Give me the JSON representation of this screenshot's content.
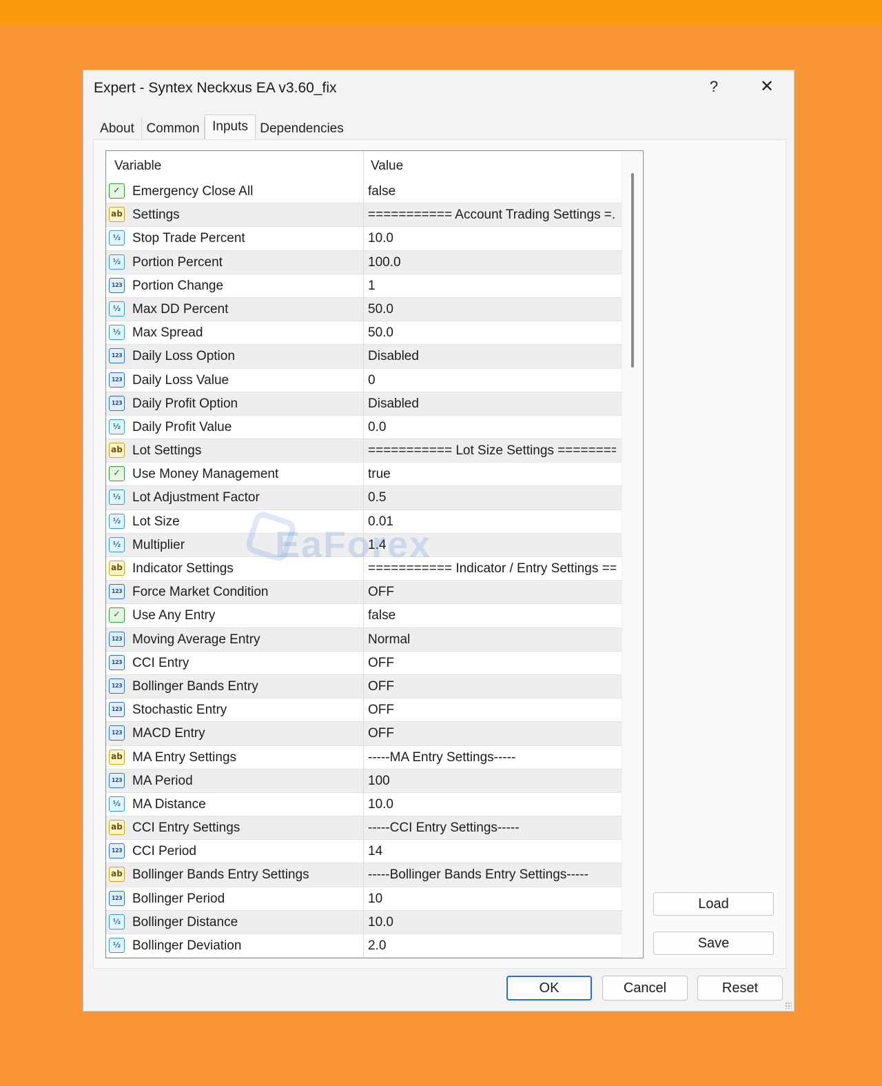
{
  "window": {
    "title": "Expert - Syntex Neckxus EA v3.60_fix",
    "help_label": "?",
    "close_label": "✕"
  },
  "tabs": [
    {
      "label": "About"
    },
    {
      "label": "Common"
    },
    {
      "label": "Inputs",
      "active": true
    },
    {
      "label": "Dependencies"
    }
  ],
  "grid": {
    "headers": {
      "variable": "Variable",
      "value": "Value"
    },
    "rows": [
      {
        "type": "bool",
        "variable": "Emergency Close All",
        "value": "false"
      },
      {
        "type": "string",
        "variable": "Settings",
        "value": "=========== Account Trading Settings =..."
      },
      {
        "type": "double",
        "variable": "Stop Trade Percent",
        "value": "10.0"
      },
      {
        "type": "double",
        "variable": "Portion Percent",
        "value": "100.0"
      },
      {
        "type": "int",
        "variable": "Portion Change",
        "value": "1"
      },
      {
        "type": "double",
        "variable": "Max DD Percent",
        "value": "50.0"
      },
      {
        "type": "double",
        "variable": "Max Spread",
        "value": "50.0"
      },
      {
        "type": "int",
        "variable": "Daily Loss Option",
        "value": "Disabled"
      },
      {
        "type": "int",
        "variable": "Daily Loss Value",
        "value": "0"
      },
      {
        "type": "int",
        "variable": "Daily Profit Option",
        "value": "Disabled"
      },
      {
        "type": "double",
        "variable": "Daily Profit Value",
        "value": "0.0"
      },
      {
        "type": "string",
        "variable": "Lot Settings",
        "value": "=========== Lot Size Settings ========..."
      },
      {
        "type": "bool",
        "variable": "Use Money Management",
        "value": "true"
      },
      {
        "type": "double",
        "variable": "Lot Adjustment Factor",
        "value": "0.5"
      },
      {
        "type": "double",
        "variable": "Lot Size",
        "value": "0.01"
      },
      {
        "type": "double",
        "variable": "Multiplier",
        "value": "1.4"
      },
      {
        "type": "string",
        "variable": "Indicator Settings",
        "value": "=========== Indicator / Entry Settings ==..."
      },
      {
        "type": "int",
        "variable": "Force Market Condition",
        "value": "OFF"
      },
      {
        "type": "bool",
        "variable": "Use Any Entry",
        "value": "false"
      },
      {
        "type": "int",
        "variable": "Moving Average Entry",
        "value": "Normal"
      },
      {
        "type": "int",
        "variable": "CCI Entry",
        "value": "OFF"
      },
      {
        "type": "int",
        "variable": "Bollinger Bands Entry",
        "value": "OFF"
      },
      {
        "type": "int",
        "variable": "Stochastic Entry",
        "value": "OFF"
      },
      {
        "type": "int",
        "variable": "MACD Entry",
        "value": "OFF"
      },
      {
        "type": "string",
        "variable": "MA Entry Settings",
        "value": "-----MA Entry Settings-----"
      },
      {
        "type": "int",
        "variable": "MA Period",
        "value": "100"
      },
      {
        "type": "double",
        "variable": "MA Distance",
        "value": "10.0"
      },
      {
        "type": "string",
        "variable": "CCI Entry Settings",
        "value": "-----CCI Entry Settings-----"
      },
      {
        "type": "int",
        "variable": "CCI Period",
        "value": "14"
      },
      {
        "type": "string",
        "variable": "Bollinger Bands Entry Settings",
        "value": "-----Bollinger Bands Entry Settings-----"
      },
      {
        "type": "int",
        "variable": "Bollinger Period",
        "value": "10"
      },
      {
        "type": "double",
        "variable": "Bollinger Distance",
        "value": "10.0"
      },
      {
        "type": "double",
        "variable": "Bollinger Deviation",
        "value": "2.0"
      }
    ]
  },
  "icon_glyphs": {
    "bool": "✓",
    "string": "ab",
    "double": "½",
    "int": "123"
  },
  "watermark": "EaForex",
  "buttons": {
    "load": "Load",
    "save": "Save",
    "ok": "OK",
    "cancel": "Cancel",
    "reset": "Reset"
  },
  "colors": {
    "background": "#f99532",
    "primary_button_border": "#1f6fcf"
  }
}
